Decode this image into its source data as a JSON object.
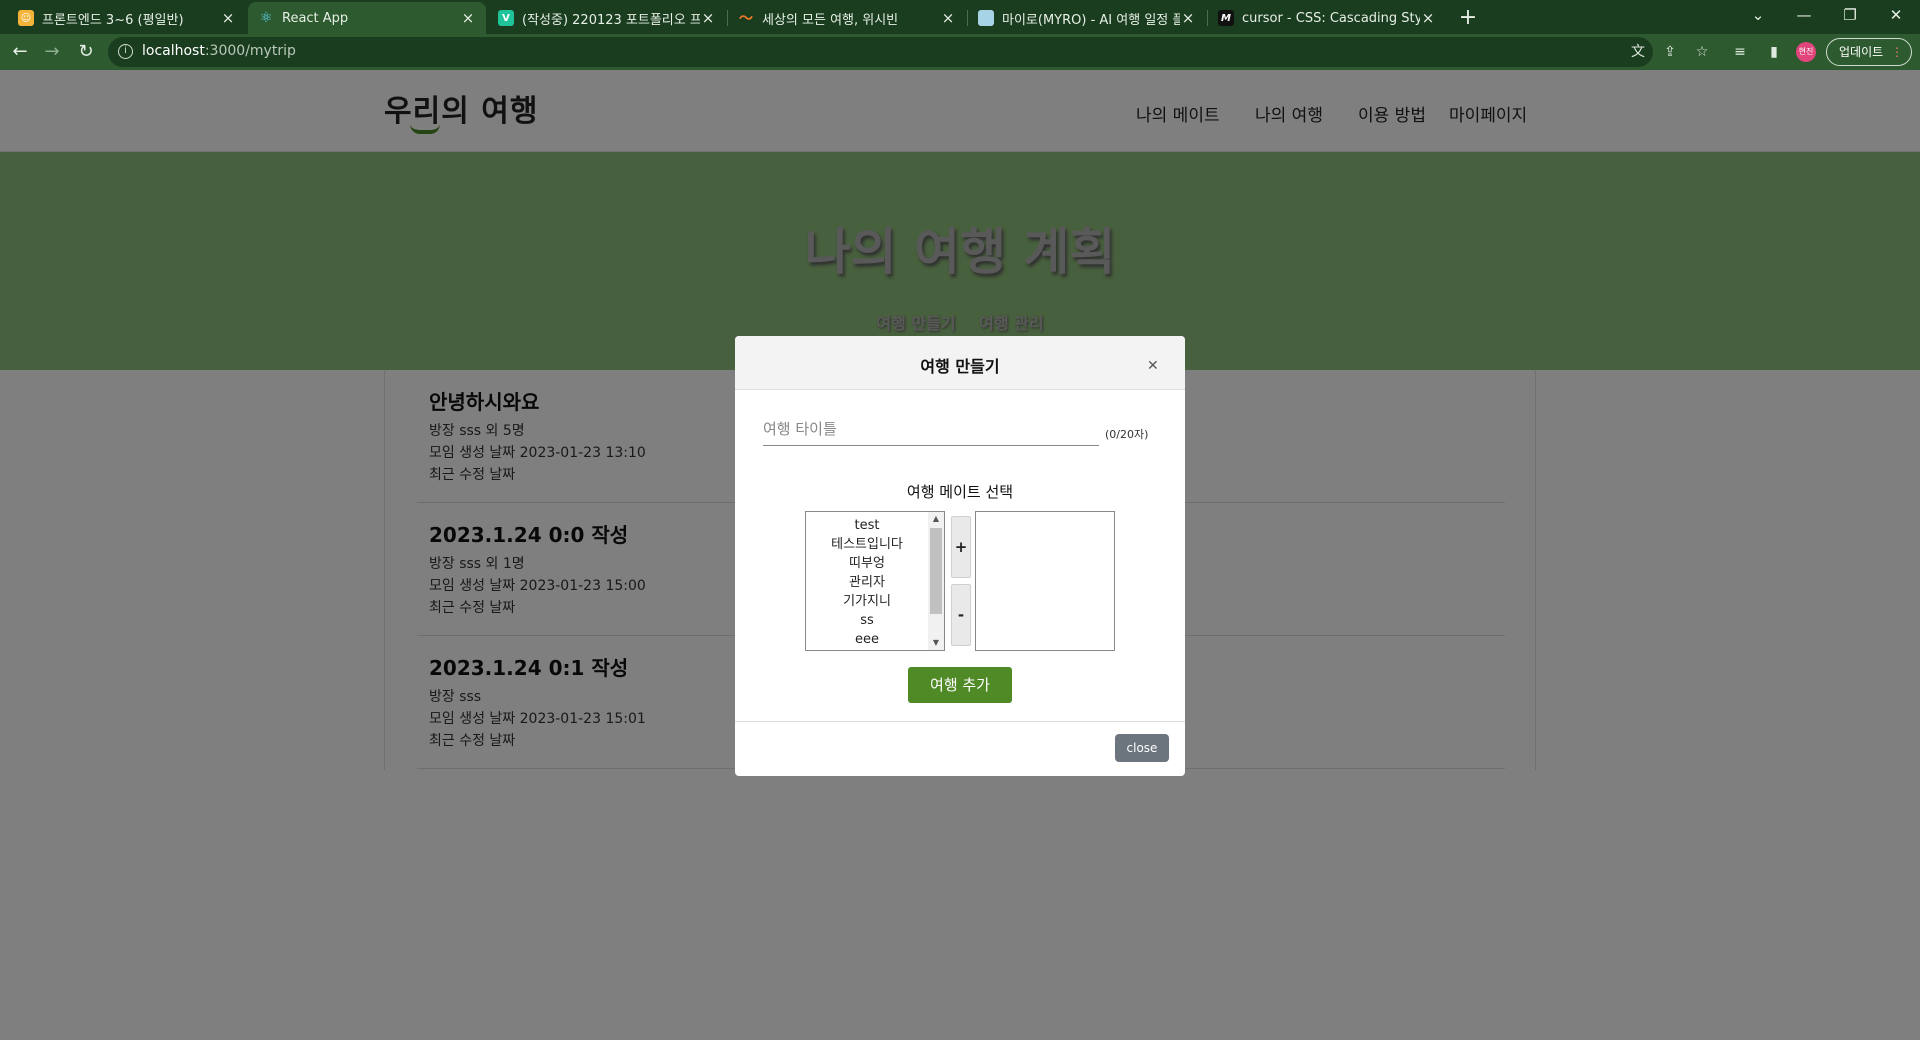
{
  "browser": {
    "tabs": [
      {
        "title": "프론트엔드 3~6 (평일반)",
        "favicon": "emoji-face-icon"
      },
      {
        "title": "React App",
        "favicon": "react-icon"
      },
      {
        "title": "(작성중) 220123 포트폴리오 프로",
        "favicon": "v-icon"
      },
      {
        "title": "세상의 모든 여행, 위시빈",
        "favicon": "wishbeen-icon"
      },
      {
        "title": "마이로(MYRO) - AI 여행 일정 플",
        "favicon": "myro-icon"
      },
      {
        "title": "cursor - CSS: Cascading Style Sh",
        "favicon": "mdn-icon"
      }
    ],
    "url_host": "localhost",
    "url_path": ":3000/mytrip",
    "profile_initials": "현진",
    "update_label": "업데이트"
  },
  "site": {
    "logo": "우리의 여행",
    "menu": [
      "나의 메이트",
      "나의 여행",
      "이용 방법",
      "마이페이지"
    ]
  },
  "hero": {
    "title": "나의 여행 계획",
    "links": [
      "여행 만들기",
      "여행 관리"
    ]
  },
  "trips": [
    {
      "title": "안녕하시와요",
      "owner": "방장 sss 외 5명",
      "created": "모임 생성 날짜 2023-01-23 13:10",
      "modified": "최근 수정 날짜"
    },
    {
      "title": "2023.1.24 0:0 작성",
      "owner": "방장 sss 외 1명",
      "created": "모임 생성 날짜 2023-01-23 15:00",
      "modified": "최근 수정 날짜"
    },
    {
      "title": "2023.1.24 0:1 작성",
      "owner": "방장 sss",
      "created": "모임 생성 날짜 2023-01-23 15:01",
      "modified": "최근 수정 날짜"
    }
  ],
  "modal": {
    "title": "여행 만들기",
    "title_placeholder": "여행 타이틀",
    "char_count": "(0/20자)",
    "mate_label": "여행 메이트 선택",
    "mates": [
      "test",
      "테스트입니다",
      "띠부엉",
      "관리자",
      "기가지니",
      "ss",
      "eee"
    ],
    "add_label": "+",
    "remove_label": "-",
    "submit_label": "여행 추가",
    "close_label": "close"
  }
}
